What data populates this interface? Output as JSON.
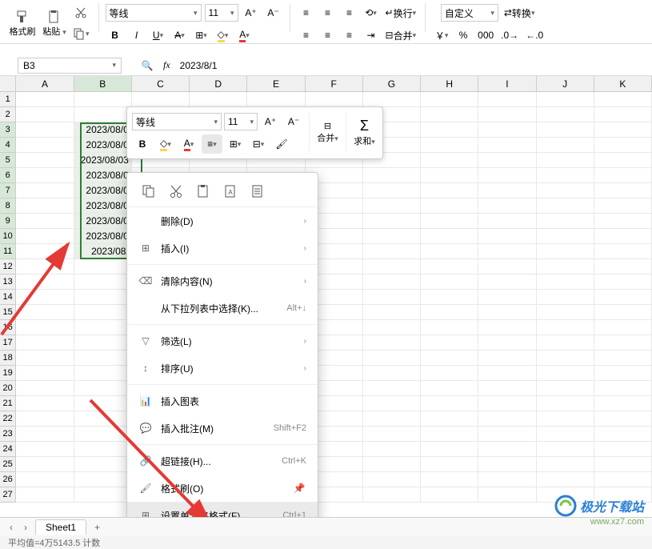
{
  "ribbon": {
    "format_painter": "格式刷",
    "paste": "粘贴",
    "font_name": "等线",
    "font_size": "11",
    "wrap_text": "换行",
    "merge": "合并",
    "num_format": "自定义",
    "convert": "转换",
    "symbols": {
      "currency": "￥",
      "percent": "%",
      "comma": "000",
      "dec_inc": ".00",
      "dec_dec": "00."
    }
  },
  "namebox": "B3",
  "formula": "2023/8/1",
  "columns": [
    "A",
    "B",
    "C",
    "D",
    "E",
    "F",
    "G",
    "H",
    "I",
    "J",
    "K"
  ],
  "data_col_b": [
    "2023/08/0",
    "2023/08/0",
    "2023/08/03",
    "2023/08/0",
    "2023/08/0",
    "2023/08/0",
    "2023/08/0",
    "2023/08/0",
    "2023/08/"
  ],
  "mini": {
    "font_name": "等线",
    "font_size": "11",
    "merge_label": "合并",
    "sum_label": "求和"
  },
  "ctx": {
    "delete": "删除(D)",
    "insert": "插入(I)",
    "clear": "清除内容(N)",
    "pick_list": "从下拉列表中选择(K)...",
    "pick_list_sc": "Alt+↓",
    "filter": "筛选(L)",
    "sort": "排序(U)",
    "insert_chart": "插入图表",
    "insert_comment": "插入批注(M)",
    "insert_comment_sc": "Shift+F2",
    "hyperlink": "超链接(H)...",
    "hyperlink_sc": "Ctrl+K",
    "format_painter": "格式刷(O)",
    "format_cells": "设置单元格格式(F)...",
    "format_cells_sc": "Ctrl+1"
  },
  "tabs": {
    "sheet1": "Sheet1",
    "add": "+"
  },
  "status_text": "平均值=4万5143.5  计数",
  "watermark": {
    "title": "极光下载站",
    "url": "www.xz7.com"
  }
}
